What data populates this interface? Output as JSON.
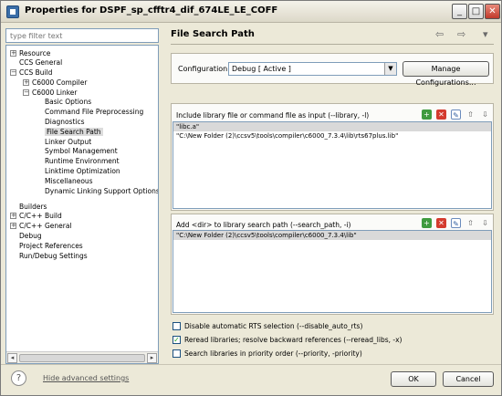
{
  "window": {
    "title": "Properties for DSPF_sp_cfftr4_dif_674LE_LE_COFF",
    "controls": [
      "minimize",
      "maximize",
      "close"
    ]
  },
  "filter": {
    "placeholder": "type filter text"
  },
  "tree": {
    "items": [
      {
        "label": "Resource",
        "expander": "+"
      },
      {
        "label": "CCS General"
      },
      {
        "label": "CCS Build",
        "expander": "−"
      },
      {
        "label": "C6000 Compiler",
        "expander": "+"
      },
      {
        "label": "C6000 Linker",
        "expander": "−"
      },
      {
        "label": "Basic Options"
      },
      {
        "label": "Command File Preprocessing"
      },
      {
        "label": "Diagnostics"
      },
      {
        "label": "File Search Path",
        "selected": true
      },
      {
        "label": "Linker Output"
      },
      {
        "label": "Symbol Management"
      },
      {
        "label": "Runtime Environment"
      },
      {
        "label": "Linktime Optimization"
      },
      {
        "label": "Miscellaneous"
      },
      {
        "label": "Dynamic Linking Support Options"
      },
      {
        "label": "Builders"
      },
      {
        "label": "C/C++ Build",
        "expander": "+"
      },
      {
        "label": "C/C++ General",
        "expander": "+"
      },
      {
        "label": "Debug"
      },
      {
        "label": "Project References"
      },
      {
        "label": "Run/Debug Settings"
      }
    ]
  },
  "page": {
    "title": "File Search Path",
    "nav_back": "⇦",
    "nav_forward": "⇨",
    "nav_menu": "▾"
  },
  "configuration": {
    "label": "Configuration:",
    "value": "Debug  [ Active ]",
    "manage_button": "Manage Configurations..."
  },
  "include_section": {
    "label": "Include library file or command file as input (--library, -l)",
    "items": [
      "\"libc.a\"",
      "\"C:\\New Folder (2)\\ccsv5\\tools\\compiler\\c6000_7.3.4\\lib\\rts67plus.lib\""
    ],
    "selected_index": 0
  },
  "search_section": {
    "label": "Add <dir> to library search path (--search_path, -i)",
    "items": [
      "\"C:\\New Folder (2)\\ccsv5\\tools\\compiler\\c6000_7.3.4\\lib\""
    ],
    "selected_index": 0
  },
  "options": [
    {
      "label": "Disable automatic RTS selection (--disable_auto_rts)",
      "checked": false
    },
    {
      "label": "Reread libraries; resolve backward references (--reread_libs, -x)",
      "checked": true
    },
    {
      "label": "Search libraries in priority order (--priority, -priority)",
      "checked": false
    }
  ],
  "footer": {
    "help_icon": "?",
    "hide_advanced": "Hide advanced settings",
    "ok": "OK",
    "cancel": "Cancel"
  }
}
